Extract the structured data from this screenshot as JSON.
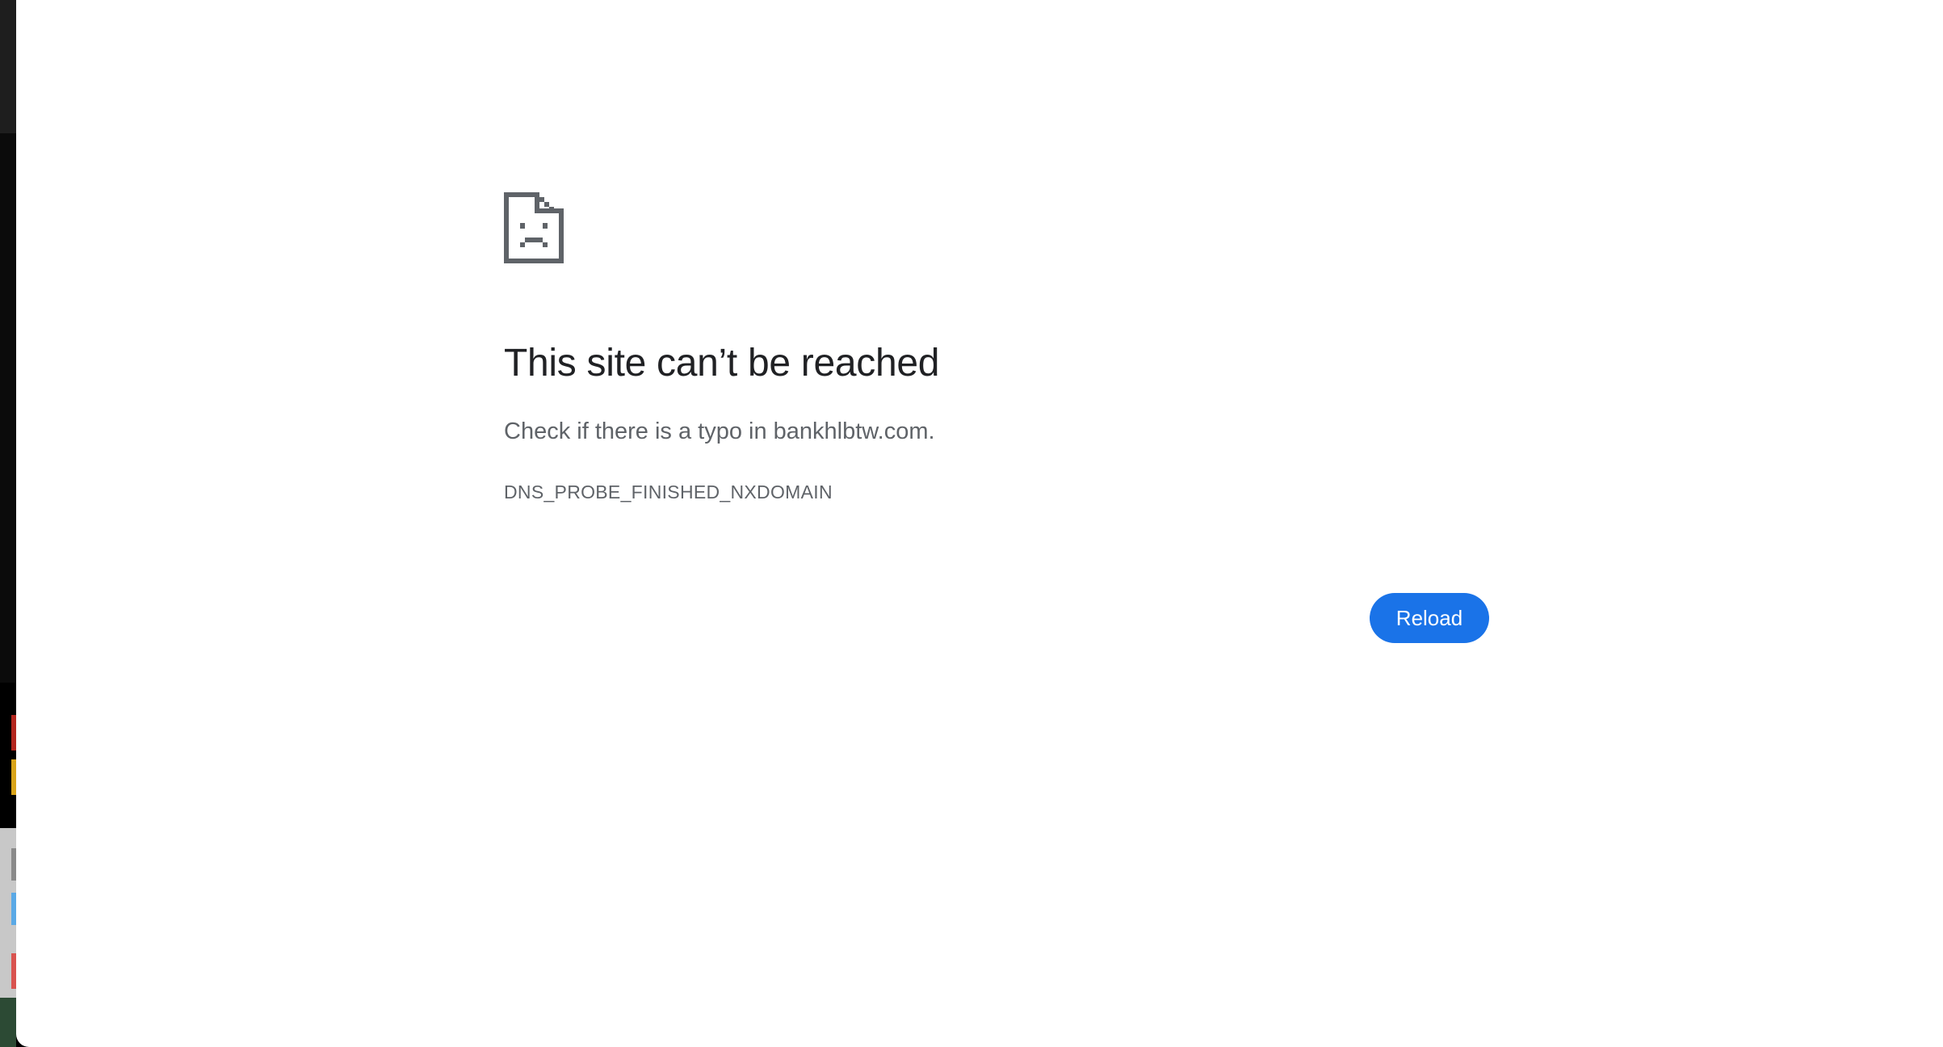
{
  "error_page": {
    "icon": "sad-file-icon",
    "title": "This site can’t be reached",
    "message": "Check if there is a typo in bankhlbtw.com.",
    "error_code": "DNS_PROBE_FINISHED_NXDOMAIN",
    "reload_label": "Reload"
  },
  "colors": {
    "button": "#1a73e8",
    "title": "#202124",
    "text": "#5f6368",
    "icon": "#5f6368"
  }
}
